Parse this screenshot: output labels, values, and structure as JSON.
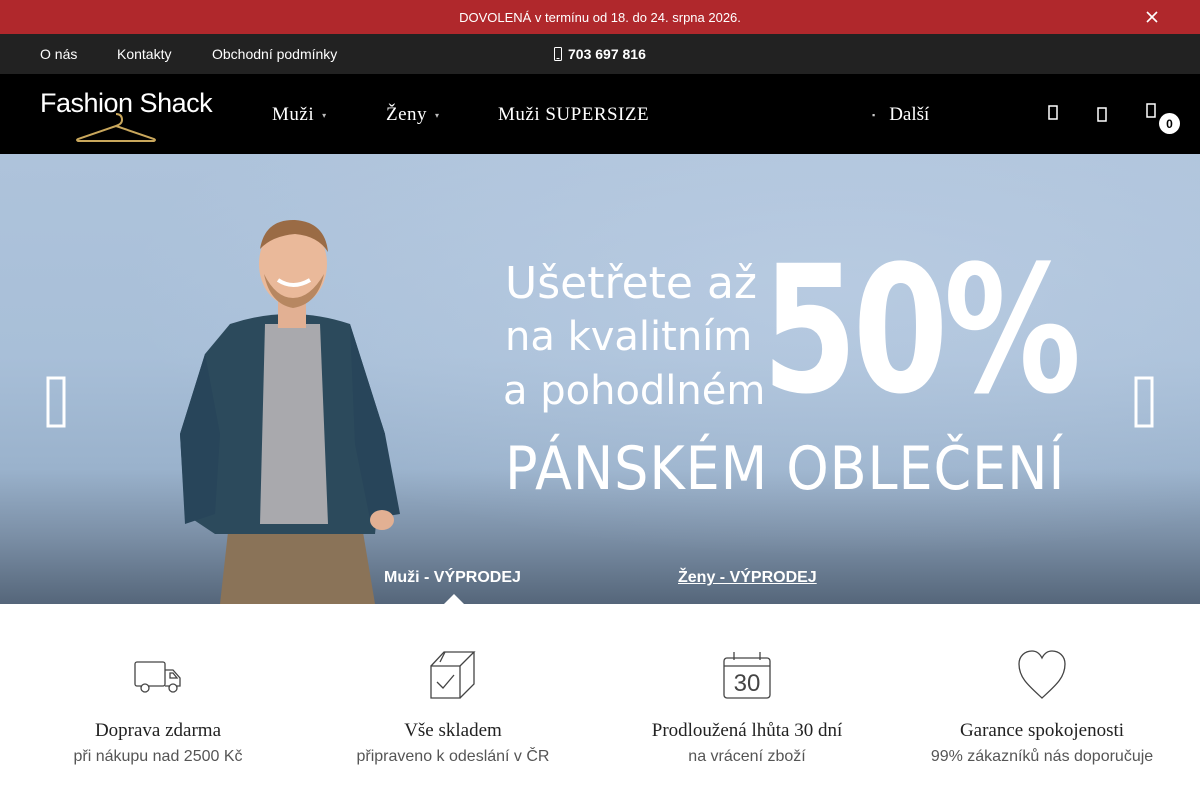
{
  "announcement": {
    "text": "DOVOLENÁ v termínu od 18. do 24. srpna 2026.",
    "close_icon": "close-icon"
  },
  "topbar": {
    "links": [
      "O nás",
      "Kontakty",
      "Obchodní podmínky"
    ],
    "phone": "703 697 816",
    "phone_icon": "phone-icon"
  },
  "header": {
    "logo_text": "Fashion Shack",
    "nav": [
      "Muži",
      "Ženy",
      "Muži SUPERSIZE"
    ],
    "more_label": "Další",
    "cart_count": "0",
    "icons": [
      "search-icon",
      "user-icon",
      "cart-icon"
    ]
  },
  "hero": {
    "line1": "Ušetřete až",
    "line2": "na kvalitním",
    "line3": "a pohodlném",
    "big": "50%",
    "line4": "PÁNSKÉM OBLEČENÍ",
    "tabs": [
      "Muži - VÝPRODEJ",
      "Ženy - VÝPRODEJ"
    ],
    "prev_icon": "chevron-left-icon",
    "next_icon": "chevron-right-icon"
  },
  "features": [
    {
      "icon": "truck-icon",
      "title": "Doprava zdarma",
      "subtitle": "při nákupu nad 2500 Kč"
    },
    {
      "icon": "box-check-icon",
      "title": "Vše skladem",
      "subtitle": "připraveno k odeslání v ČR"
    },
    {
      "icon": "calendar-30-icon",
      "title": "Prodloužená lhůta 30 dní",
      "subtitle": "na vrácení zboží"
    },
    {
      "icon": "heart-icon",
      "title": "Garance spokojenosti",
      "subtitle": "99% zákazníků nás doporučuje"
    }
  ],
  "colors": {
    "announcement_bg": "#b0282c",
    "topbar_bg": "#222222",
    "header_bg": "#000000",
    "hero_bg": "#a8bfd8"
  }
}
